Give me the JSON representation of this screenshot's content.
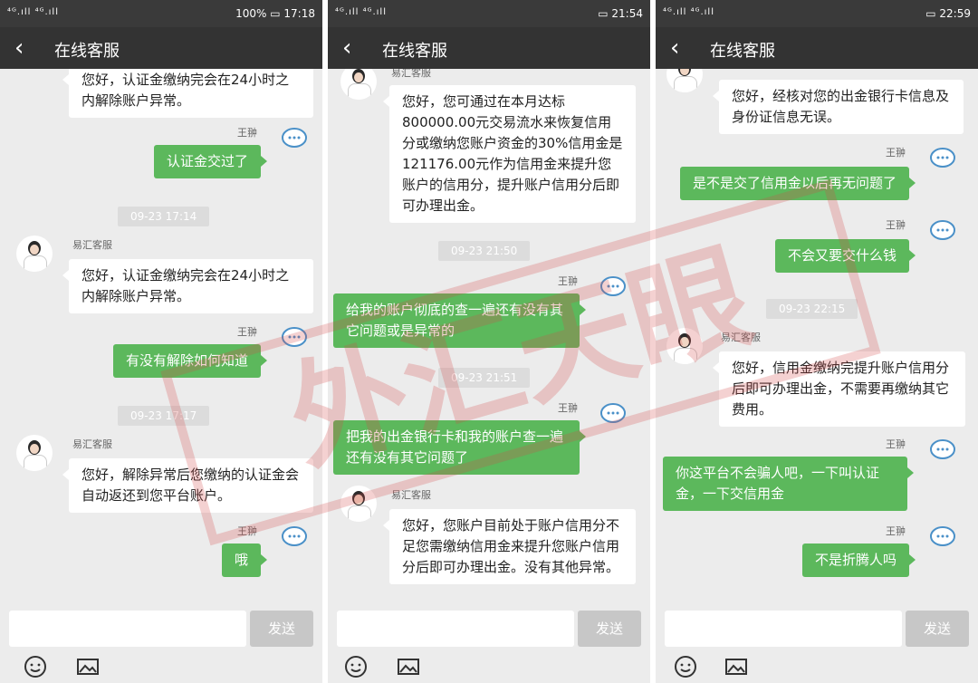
{
  "panels": [
    {
      "status": {
        "signal": "⁴ᴳ.ıll ⁴ᴳ.ıll",
        "battery": "100%",
        "time": "17:18"
      },
      "title": "在线客服",
      "messages": [
        {
          "type": "agent",
          "text": "您好，认证金缴纳完会在24小时之内解除账户异常。"
        },
        {
          "type": "name",
          "text": "王翀"
        },
        {
          "type": "user",
          "text": "认证金交过了"
        },
        {
          "type": "time",
          "text": "09-23 17:14"
        },
        {
          "type": "agentname",
          "text": "易汇客服"
        },
        {
          "type": "agent",
          "text": "您好，认证金缴纳完会在24小时之内解除账户异常。"
        },
        {
          "type": "name",
          "text": "王翀"
        },
        {
          "type": "user",
          "text": "有没有解除如何知道"
        },
        {
          "type": "time",
          "text": "09-23 17:17"
        },
        {
          "type": "agentname",
          "text": "易汇客服"
        },
        {
          "type": "agent",
          "text": "您好，解除异常后您缴纳的认证金会自动返还到您平台账户。"
        },
        {
          "type": "name",
          "text": "王翀"
        },
        {
          "type": "user",
          "text": "哦"
        }
      ],
      "send": "发送"
    },
    {
      "status": {
        "signal": "⁴ᴳ.ıll ⁴ᴳ.ıll",
        "battery": "",
        "time": "21:54"
      },
      "title": "在线客服",
      "messages": [
        {
          "type": "agentname",
          "text": "易汇客服"
        },
        {
          "type": "agent",
          "text": "您好，您可通过在本月达标800000.00元交易流水来恢复信用分或缴纳您账户资金的30%信用金是121176.00元作为信用金来提升您账户的信用分，提升账户信用分后即可办理出金。"
        },
        {
          "type": "time",
          "text": "09-23 21:50"
        },
        {
          "type": "name",
          "text": "王翀"
        },
        {
          "type": "user",
          "text": "给我的账户彻底的查一遍还有没有其它问题或是异常的"
        },
        {
          "type": "time",
          "text": "09-23 21:51"
        },
        {
          "type": "name",
          "text": "王翀"
        },
        {
          "type": "user",
          "text": "把我的出金银行卡和我的账户查一遍还有没有其它问题了"
        },
        {
          "type": "agentname",
          "text": "易汇客服"
        },
        {
          "type": "agent",
          "text": "您好，您账户目前处于账户信用分不足您需缴纳信用金来提升您账户信用分后即可办理出金。没有其他异常。"
        }
      ],
      "send": "发送"
    },
    {
      "status": {
        "signal": "⁴ᴳ.ıll ⁴ᴳ.ıll",
        "battery": "",
        "time": "22:59"
      },
      "title": "在线客服",
      "messages": [
        {
          "type": "agent",
          "text": "您好，经核对您的出金银行卡信息及身份证信息无误。"
        },
        {
          "type": "name",
          "text": "王翀"
        },
        {
          "type": "user",
          "text": "是不是交了信用金以后再无问题了"
        },
        {
          "type": "name",
          "text": "王翀"
        },
        {
          "type": "user",
          "text": "不会又要交什么钱"
        },
        {
          "type": "time",
          "text": "09-23 22:15"
        },
        {
          "type": "agentname",
          "text": "易汇客服"
        },
        {
          "type": "agent",
          "text": "您好，信用金缴纳完提升账户信用分后即可办理出金，不需要再缴纳其它费用。"
        },
        {
          "type": "name",
          "text": "王翀"
        },
        {
          "type": "user",
          "text": "你这平台不会骗人吧，一下叫认证金，一下交信用金"
        },
        {
          "type": "name",
          "text": "王翀"
        },
        {
          "type": "user",
          "text": "不是折腾人吗"
        }
      ],
      "send": "发送"
    }
  ],
  "watermark": "外汇天眼"
}
